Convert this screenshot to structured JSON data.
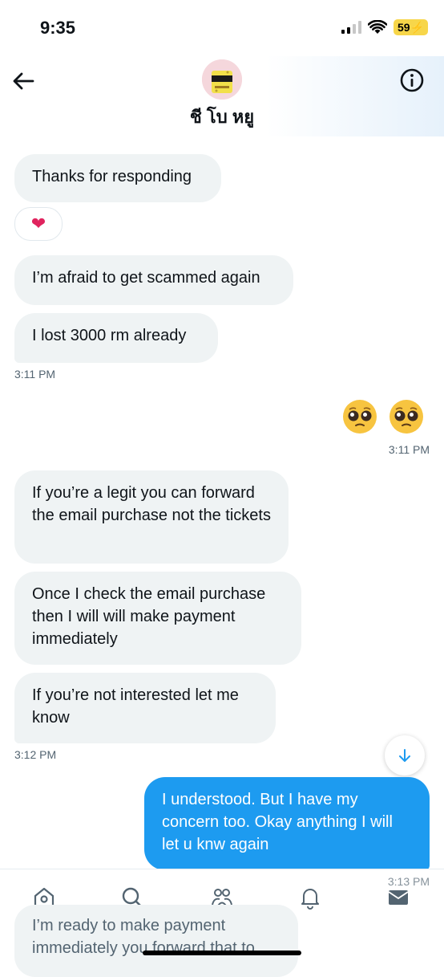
{
  "status_bar": {
    "time": "9:35",
    "battery": "59"
  },
  "header": {
    "contact_name": "ชี โบ หยู"
  },
  "messages": {
    "m1": "Thanks for responding",
    "reaction": "❤",
    "m2": "I’m afraid to get scammed again",
    "m3": "I lost 3000 rm already",
    "t1": "3:11 PM",
    "t2": "3:11 PM",
    "m4": "If you’re a legit you can forward the email purchase not the tickets",
    "m5": "Once I check the email purchase then I will will make payment immediately",
    "m6": "If you’re not interested let me know",
    "t3": "3:12 PM",
    "m7": "I understood. But I have my concern too. Okay anything I will let u knw again",
    "t4": "3:13 PM"
  },
  "draft": {
    "text": "I’m ready to make payment immediately you forward that to"
  },
  "colors": {
    "accent": "#1d9bf0",
    "bubble_in": "#eff3f4",
    "timestamp": "#536471"
  },
  "icons": {
    "back": "arrow-left-icon",
    "info": "info-icon",
    "scroll_down": "arrow-down-icon",
    "nav": [
      "home-icon",
      "search-icon",
      "communities-icon",
      "bell-icon",
      "mail-icon"
    ]
  }
}
